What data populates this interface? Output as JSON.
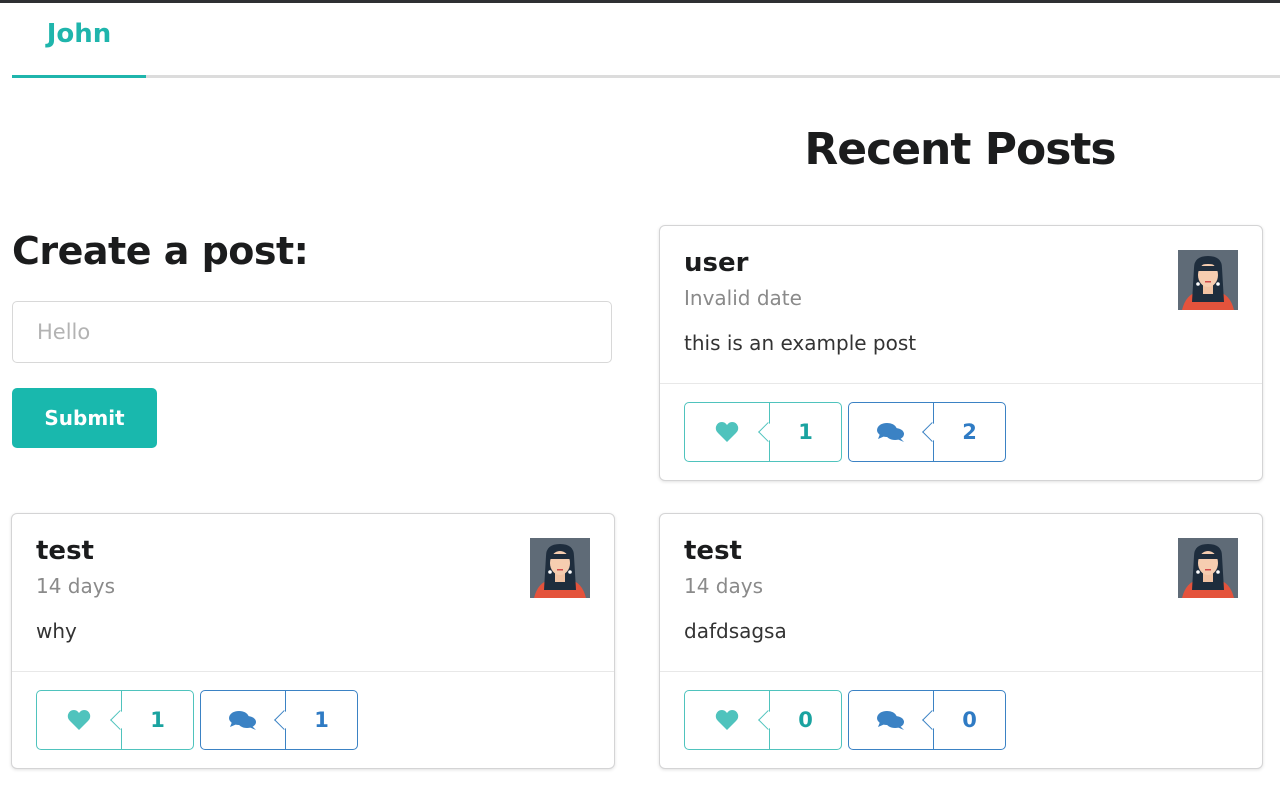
{
  "nav": {
    "active_tab": "John"
  },
  "recent_heading": "Recent Posts",
  "create_form": {
    "heading": "Create a post:",
    "input_placeholder": "Hello",
    "input_value": "",
    "submit_label": "Submit"
  },
  "colors": {
    "accent": "#19b8ad",
    "like": "#4fc3bd",
    "comment": "#3b82c4"
  },
  "posts": [
    {
      "author": "user",
      "date": "Invalid date",
      "body": "this is an example post",
      "likes": "1",
      "comments": "2"
    },
    {
      "author": "test",
      "date": "14 days",
      "body": "why",
      "likes": "1",
      "comments": "1"
    },
    {
      "author": "test",
      "date": "14 days",
      "body": "dafdsagsa",
      "likes": "0",
      "comments": "0"
    }
  ]
}
